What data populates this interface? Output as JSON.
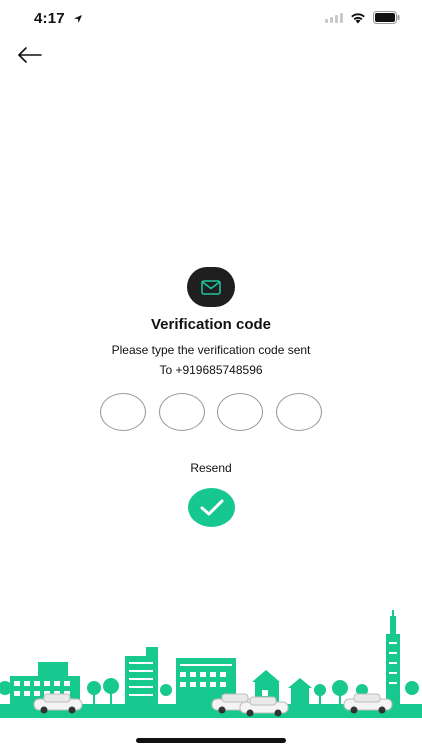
{
  "status_bar": {
    "time": "4:17",
    "location_icon": "location-arrow-icon",
    "signal_icon": "cellular-signal-icon",
    "wifi_icon": "wifi-icon",
    "battery_icon": "battery-icon"
  },
  "nav": {
    "back_icon": "arrow-left-icon"
  },
  "verification": {
    "badge_icon": "mail-icon",
    "title": "Verification code",
    "subtitle": "Please type the verification code sent",
    "phone_line": "To +919685748596",
    "otp_values": [
      "",
      "",
      "",
      ""
    ],
    "resend_label": "Resend",
    "confirm_icon": "checkmark-icon"
  },
  "colors": {
    "accent": "#16c890",
    "badge_bg": "#1f1f1f",
    "mail_icon": "#1ec8a0",
    "city_green": "#18c98f",
    "text": "#111111"
  },
  "illustration": {
    "name": "city-skyline-illustration"
  }
}
